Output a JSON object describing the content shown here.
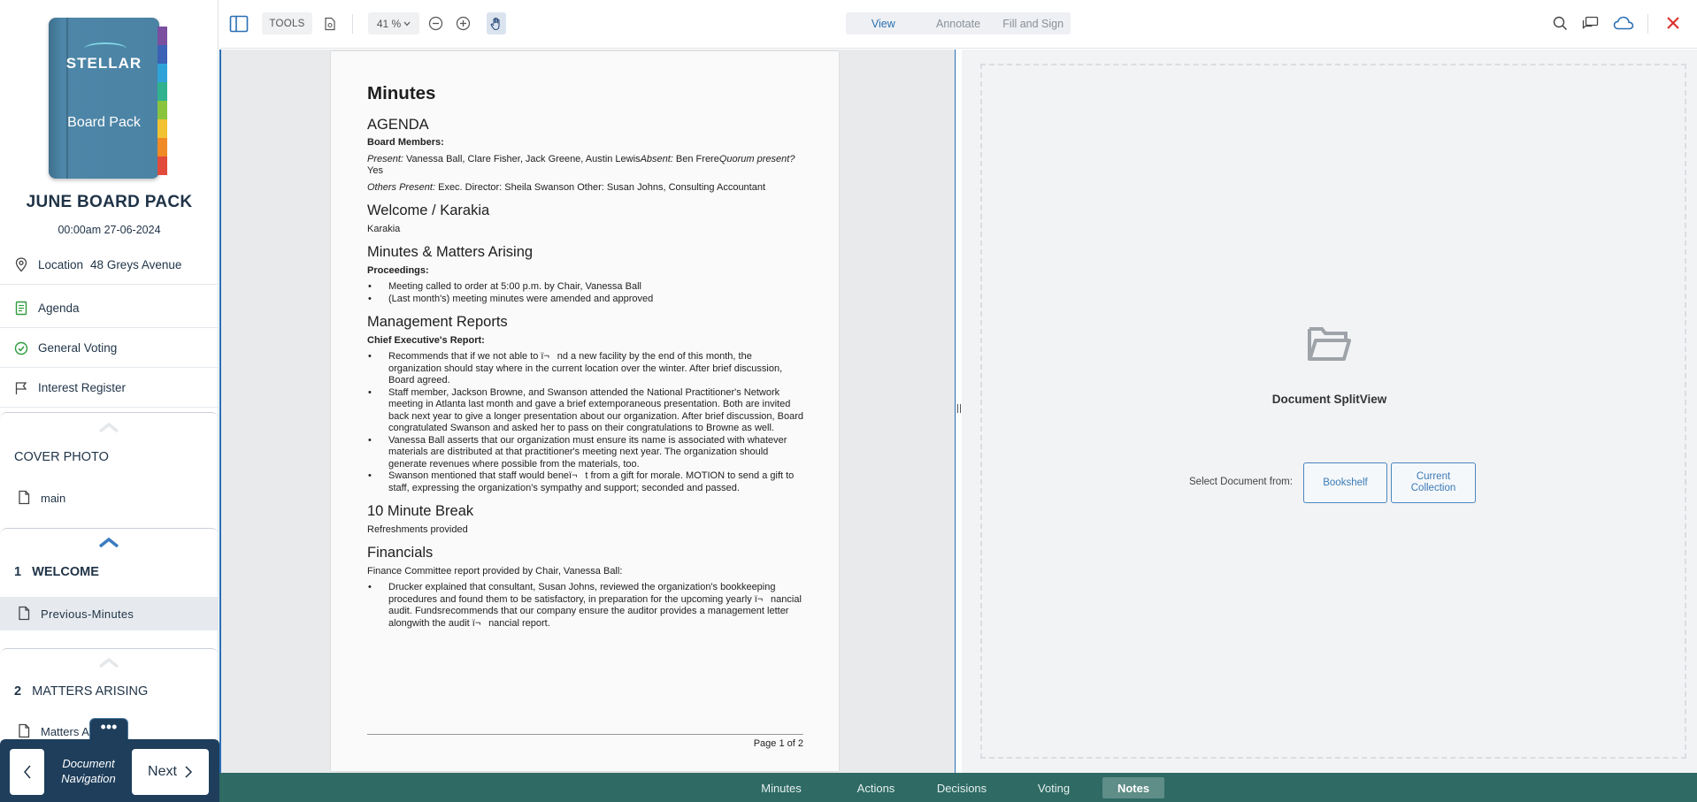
{
  "sidebar": {
    "book": {
      "logo": "STELLAR",
      "title": "Board Pack"
    },
    "pack_title": "JUNE BOARD PACK",
    "pack_date": "00:00am 27-06-2024",
    "location_label": "Location",
    "location_value": "48 Greys Avenue",
    "items": [
      {
        "label": "Agenda",
        "icon": "agenda-icon"
      },
      {
        "label": "General Voting",
        "icon": "check-circle-icon"
      },
      {
        "label": "Interest Register",
        "icon": "flag-icon"
      }
    ],
    "cover_photo": {
      "label": "COVER PHOTO",
      "file": "main"
    },
    "section1": {
      "number": "1",
      "title": "WELCOME",
      "file": "Previous-Minutes"
    },
    "section2": {
      "number": "2",
      "title": "MATTERS ARISING",
      "file": "Matters A"
    }
  },
  "docnav": {
    "more": "•••",
    "label": "Document Navigation",
    "next": "Next"
  },
  "toolbar": {
    "tools": "TOOLS",
    "zoom": "41 %",
    "modes": [
      "View",
      "Annotate",
      "Fill and Sign"
    ],
    "active_mode": "View"
  },
  "document": {
    "title": "Minutes",
    "agenda_heading": "AGENDA",
    "board_members_label": "Board Members:",
    "present_label": "Present:",
    "present_text": " Vanessa Ball, Clare Fisher, Jack Greene, Austin Lewis",
    "absent_label": "Absent:",
    "absent_text": " Ben Frere",
    "quorum_label": "Quorum present?",
    "quorum_text": " Yes",
    "others_label": "Others Present:",
    "others_text": " Exec. Director: Sheila Swanson Other: Susan Johns, Consulting Accountant",
    "welcome_heading": "Welcome / Karakia",
    "welcome_text": "Karakia",
    "minutes_heading": "Minutes & Matters Arising",
    "proceedings_label": "Proceedings:",
    "proceedings": [
      "Meeting called to order at 5:00 p.m. by Chair, Vanessa Ball",
      "(Last month's) meeting minutes were amended and approved"
    ],
    "mgmt_heading": "Management Reports",
    "ceo_label": "Chief Executive's Report:",
    "ceo_items": [
      "Recommends that if we not able to ï¬nd a new facility by the end of this month, the organization should stay where in the current location over the winter. After brief discussion, Board agreed.",
      "Staff member, Jackson Browne, and Swanson attended the National Practitioner's Network meeting in Atlanta last month and gave a brief extemporaneous presentation. Both are invited back next year to give a longer presentation about our organization. After brief discussion, Board congratulated Swanson and asked her to pass on their congratulations to Browne as well.",
      "Vanessa Ball asserts that our organization must ensure its name is associated with whatever materials are distributed at that practitioner's meeting next year. The organization should generate revenues where possible from the materials, too.",
      "Swanson mentioned that staff would beneï¬t from a gift for morale. MOTION to send a gift to staff, expressing the organization's sympathy and support; seconded and passed."
    ],
    "break_heading": "10 Minute Break",
    "break_text": "Refreshments provided",
    "financials_heading": "Financials",
    "financials_text": "Finance Committee report provided by Chair, Vanessa Ball:",
    "financials_items": [
      "Drucker explained that consultant, Susan Johns, reviewed the organization's bookkeeping procedures and found them to be satisfactory, in preparation for the upcoming yearly ï¬nancial audit. Fundsrecommends that our company ensure the auditor provides a management letter alongwith the audit ï¬nancial report."
    ],
    "footer": "Page 1 of 2"
  },
  "splitview": {
    "title": "Document SplitView",
    "select_label": "Select Document from:",
    "bookshelf": "Bookshelf",
    "current_collection": "Current Collection"
  },
  "bottom_tabs": [
    "Minutes",
    "Actions",
    "Decisions",
    "Voting",
    "Notes"
  ],
  "active_bottom_tab": "Notes",
  "colors": {
    "brand_navy": "#1e3e5b",
    "accent_blue": "#2b6fb3",
    "bottom_bar": "#2f6a64",
    "close_red": "#d9302c"
  }
}
